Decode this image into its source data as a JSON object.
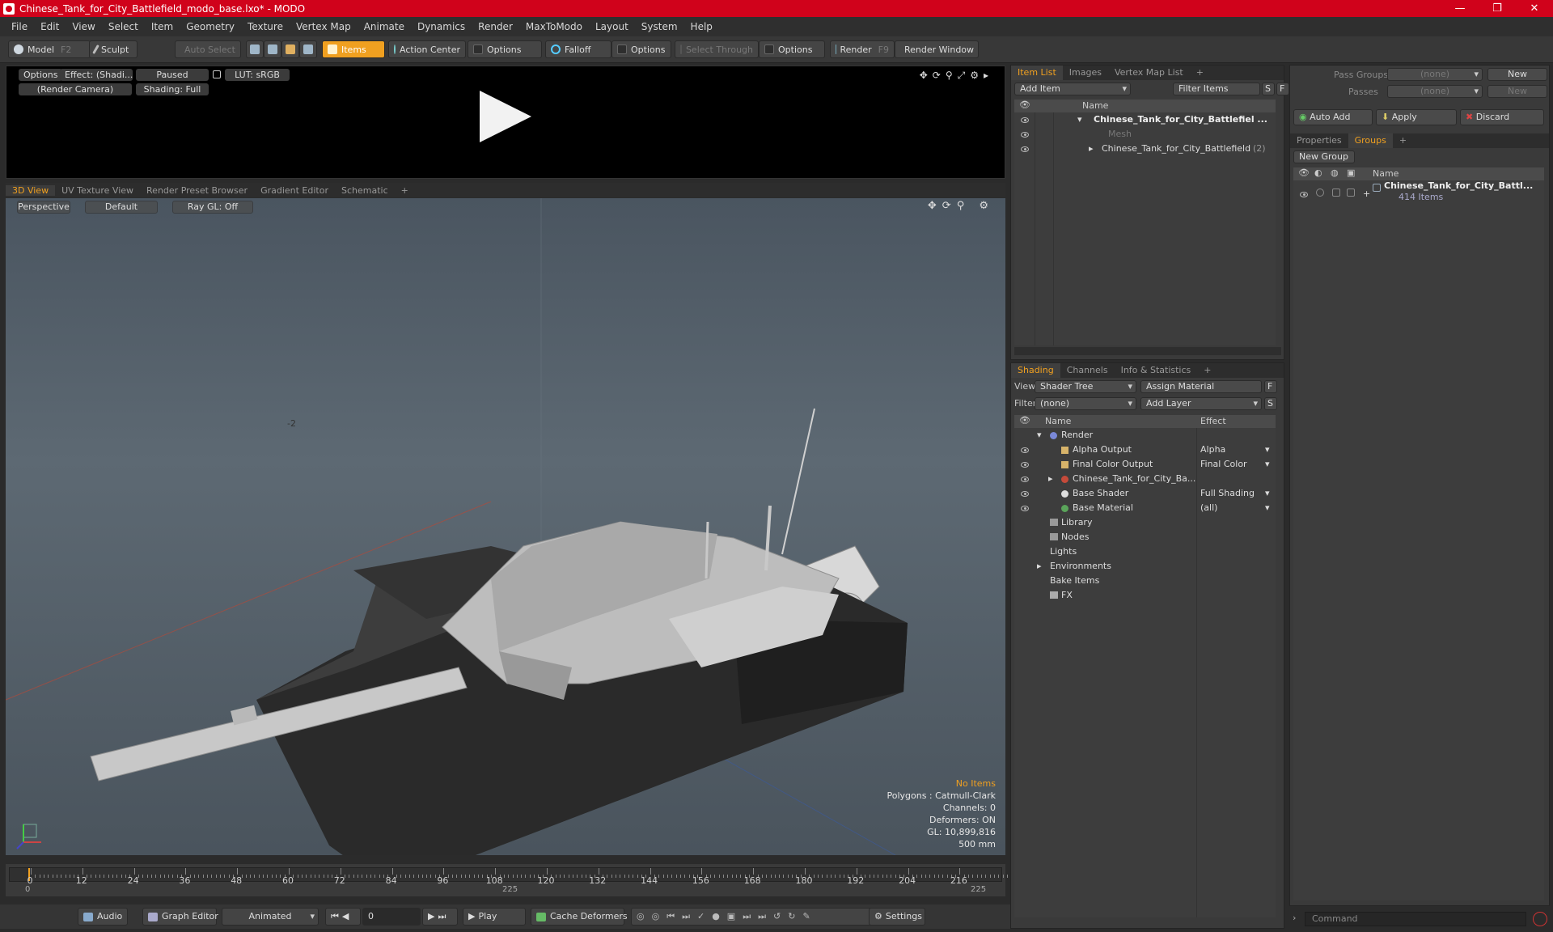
{
  "window": {
    "title": "Chinese_Tank_for_City_Battlefield_modo_base.lxo* - MODO",
    "minimize": "—",
    "maximize": "❐",
    "close": "✕"
  },
  "menu": [
    "File",
    "Edit",
    "View",
    "Select",
    "Item",
    "Geometry",
    "Texture",
    "Vertex Map",
    "Animate",
    "Dynamics",
    "Render",
    "MaxToModo",
    "Layout",
    "System",
    "Help"
  ],
  "toolbar": {
    "model": "Model",
    "model_key": "F2",
    "sculpt": "Sculpt",
    "auto_select": "Auto Select",
    "items": "Items",
    "action_center": "Action Center",
    "options1": "Options",
    "falloff": "Falloff",
    "options2": "Options",
    "select_through": "Select Through",
    "options3": "Options",
    "render": "Render",
    "render_key": "F9",
    "render_window": "Render Window"
  },
  "render_preview": {
    "options": "Options",
    "effect": "Effect: (Shadi...",
    "paused": "Paused",
    "lut": "LUT: sRGB",
    "camera": "(Render Camera)",
    "shading": "Shading: Full"
  },
  "viewport_tabs": [
    "3D View",
    "UV Texture View",
    "Render Preset Browser",
    "Gradient Editor",
    "Schematic",
    "+"
  ],
  "viewport": {
    "perspective": "Perspective",
    "default": "Default",
    "raygl": "Ray GL: Off",
    "info": {
      "no_items": "No Items",
      "polygons": "Polygons : Catmull-Clark",
      "channels": "Channels: 0",
      "deformers": "Deformers: ON",
      "gl": "GL: 10,899,816",
      "scale": "500 mm"
    },
    "axis_mark": "-2"
  },
  "timeline": {
    "ticks": [
      "0",
      "12",
      "24",
      "36",
      "48",
      "60",
      "72",
      "84",
      "96",
      "108",
      "120",
      "132",
      "144",
      "156",
      "168",
      "180",
      "192",
      "204",
      "216"
    ],
    "range_start": "0",
    "range_mid": "225",
    "range_end": "225"
  },
  "bottom": {
    "audio": "Audio",
    "graph_editor": "Graph Editor",
    "animated": "Animated",
    "frame": "0",
    "play": "Play",
    "cache_deformers": "Cache Deformers",
    "settings": "Settings"
  },
  "item_list": {
    "tabs": [
      "Item List",
      "Images",
      "Vertex Map List",
      "+"
    ],
    "add_item": "Add Item",
    "filter_items": "Filter Items",
    "s": "S",
    "f": "F",
    "col_name": "Name",
    "rows": [
      {
        "label": "Chinese_Tank_for_City_Battlefiel ...",
        "extra": ""
      },
      {
        "label": "Mesh",
        "extra": ""
      },
      {
        "label": "Chinese_Tank_for_City_Battlefield",
        "extra": "(2)"
      }
    ]
  },
  "shading": {
    "tabs": [
      "Shading",
      "Channels",
      "Info & Statistics",
      "+"
    ],
    "view_label": "View",
    "view_value": "Shader Tree",
    "assign_material": "Assign Material",
    "f": "F",
    "filter_label": "Filter",
    "filter_value": "(none)",
    "add_layer": "Add Layer",
    "s": "S",
    "col_name": "Name",
    "col_effect": "Effect",
    "rows": [
      {
        "name": "Render",
        "effect": ""
      },
      {
        "name": "Alpha Output",
        "effect": "Alpha"
      },
      {
        "name": "Final Color Output",
        "effect": "Final Color"
      },
      {
        "name": "Chinese_Tank_for_City_Ba...",
        "effect": ""
      },
      {
        "name": "Base Shader",
        "effect": "Full Shading"
      },
      {
        "name": "Base Material",
        "effect": "(all)"
      },
      {
        "name": "Library",
        "effect": ""
      },
      {
        "name": "Nodes",
        "effect": ""
      },
      {
        "name": "Lights",
        "effect": ""
      },
      {
        "name": "Environments",
        "effect": ""
      },
      {
        "name": "Bake Items",
        "effect": ""
      },
      {
        "name": "FX",
        "effect": ""
      }
    ]
  },
  "groups": {
    "pass_groups_label": "Pass Groups",
    "pass_groups_value": "(none)",
    "new": "New",
    "passes_label": "Passes",
    "passes_value": "(none)",
    "new2": "New",
    "auto_add": "Auto Add",
    "apply": "Apply",
    "discard": "Discard",
    "tabs": [
      "Properties",
      "Groups",
      "+"
    ],
    "new_group": "New Group",
    "col_name": "Name",
    "group_name": "Chinese_Tank_for_City_Battl...",
    "group_count": "414 Items"
  },
  "command": {
    "placeholder": "Command"
  }
}
